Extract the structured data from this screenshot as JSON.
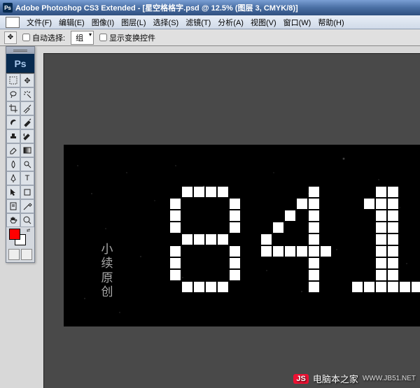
{
  "title": "Adobe Photoshop CS3 Extended - [星空格格字.psd @ 12.5% (图层 3, CMYK/8)]",
  "ps_abbrev": "Ps",
  "menu": {
    "file": "文件(F)",
    "edit": "编辑(E)",
    "image": "图像(I)",
    "layer": "图层(L)",
    "select": "选择(S)",
    "filter": "滤镜(T)",
    "analysis": "分析(A)",
    "view": "视图(V)",
    "window": "窗口(W)",
    "help": "帮助(H)"
  },
  "options": {
    "auto_select": "自动选择:",
    "dropdown": "组",
    "show_transform": "显示变换控件"
  },
  "colors": {
    "fg": "#ff0000",
    "bg": "#ffffff"
  },
  "canvas": {
    "digits": "841",
    "watermark_l1": "小",
    "watermark_l2": "续原",
    "watermark_l3": "创"
  },
  "footer": {
    "badge": "JS",
    "site": "电脑本之家",
    "url": "WWW.JB51.NET"
  }
}
